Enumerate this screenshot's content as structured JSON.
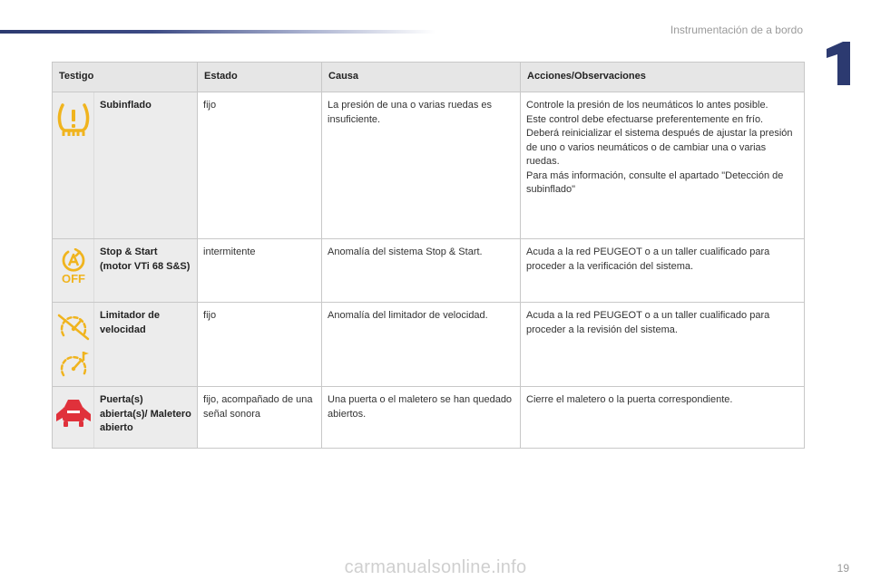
{
  "header": {
    "section_title": "Instrumentación de a bordo",
    "chapter_number": "1",
    "accent_color": "#2c3a70"
  },
  "table": {
    "headers": [
      "Testigo",
      "Estado",
      "Causa",
      "Acciones/Observaciones"
    ],
    "rows": [
      {
        "icons": [
          "tire-pressure-warning-icon"
        ],
        "icon_color": "#f0b41e",
        "name": "Subinflado",
        "estado": "fijo",
        "causa": "La presión de una o varias ruedas es insuficiente.",
        "acciones": "Controle la presión de los neumáticos lo antes posible.\nEste control debe efectuarse preferentemente en frío.\nDeberá reinicializar el sistema después de ajustar la presión de uno o varios neumáticos o de cambiar una o varias ruedas.\nPara más información, consulte el apartado \"Detección de subinflado\""
      },
      {
        "icons": [
          "stop-start-off-icon"
        ],
        "icon_color": "#f0b41e",
        "icon_text": "OFF",
        "name": "Stop & Start (motor VTi 68 S&S)",
        "estado": "intermitente",
        "causa": "Anomalía del sistema Stop & Start.",
        "acciones": "Acuda a la red PEUGEOT o a un taller cualificado para proceder a la verificación del sistema."
      },
      {
        "icons": [
          "speed-limiter-fault-icon",
          "speed-limiter-icon"
        ],
        "icon_color": "#f0b41e",
        "name": "Limitador de velocidad",
        "estado": "fijo",
        "causa": "Anomalía del limitador de velocidad.",
        "acciones": "Acuda a la red PEUGEOT o a un taller cualificado para proceder a la revisión del sistema."
      },
      {
        "icons": [
          "door-open-icon"
        ],
        "icon_color": "#e0313b",
        "name": "Puerta(s) abierta(s)/ Maletero abierto",
        "estado": "fijo, acompañado de una señal sonora",
        "causa": "Una puerta o el maletero se han quedado abiertos.",
        "acciones": "Cierre el maletero o la puerta correspondiente."
      }
    ]
  },
  "footer": {
    "watermark": "carmanualsonline.info",
    "page_number": "19"
  }
}
